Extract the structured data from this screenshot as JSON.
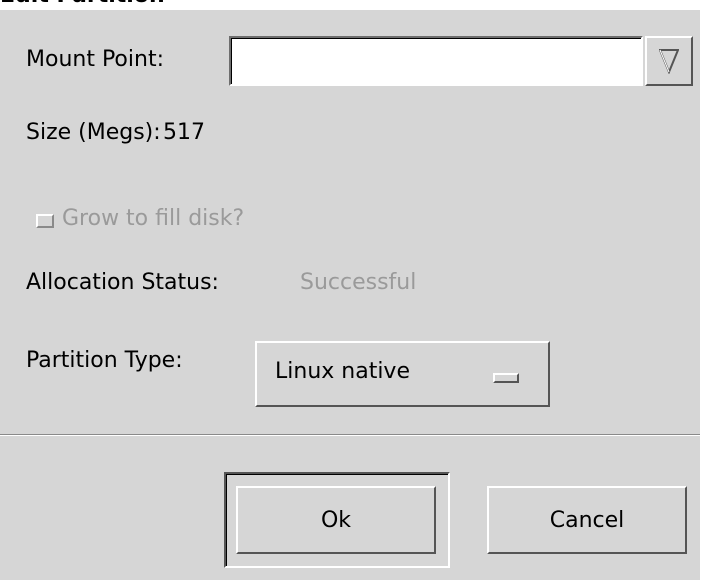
{
  "window": {
    "title": "Edit Partition"
  },
  "form": {
    "mount_point_label": "Mount Point:",
    "mount_point_value": "",
    "size_label": "Size (Megs):",
    "size_value": "517",
    "grow_label": "Grow to fill disk?",
    "allocation_label": "Allocation Status:",
    "allocation_value": "Successful",
    "partition_type_label": "Partition Type:",
    "partition_type_value": "Linux native"
  },
  "buttons": {
    "ok_label": "Ok",
    "cancel_label": "Cancel"
  },
  "icons": {
    "combo": "triangle-down-icon"
  },
  "colors": {
    "dialog_bg": "#d6d6d6",
    "disabled_text": "#9a9a9a"
  }
}
